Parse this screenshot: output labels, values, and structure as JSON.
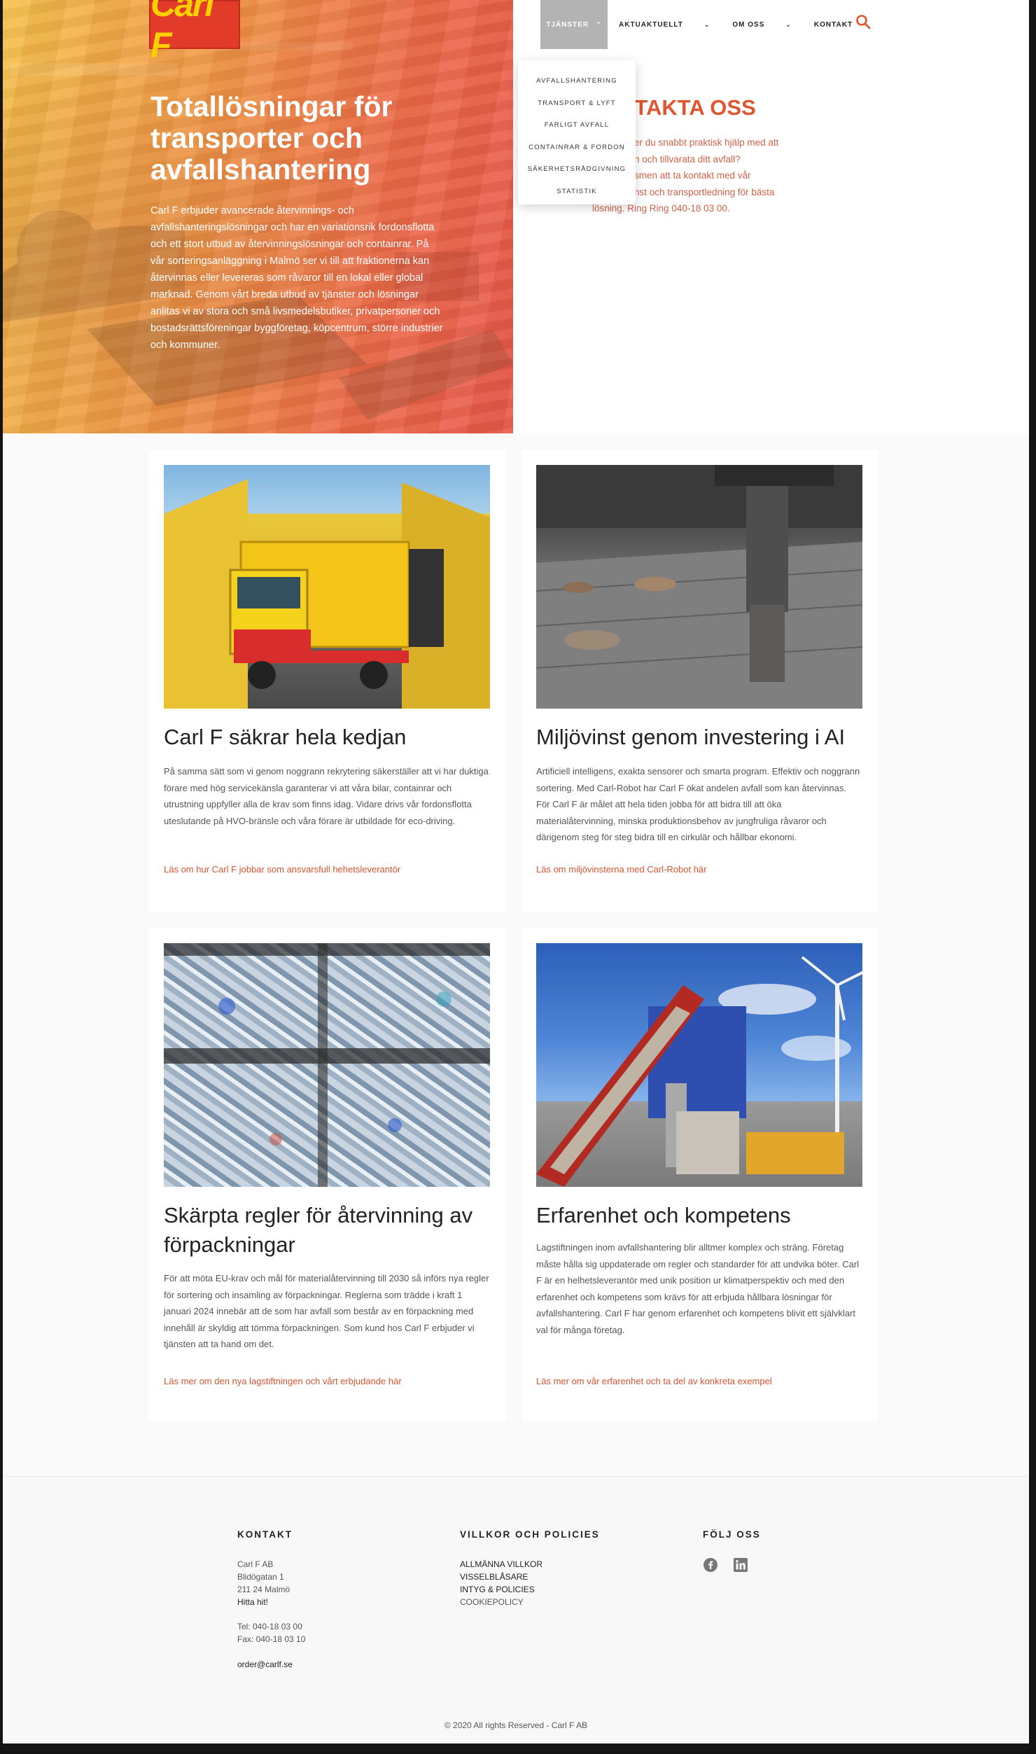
{
  "brand": {
    "logo_text": "Carl F",
    "accent": "#e0562f",
    "logo_bg": "#e23b2a",
    "logo_fg": "#ffd000"
  },
  "nav": {
    "items": [
      {
        "label": "TJÄNSTER",
        "chevron": "⌃"
      },
      {
        "label": "AKTUAKTUELLT",
        "chevron": "⌄"
      },
      {
        "label": "OM OSS",
        "chevron": "⌄"
      },
      {
        "label": "KONTAKT"
      }
    ],
    "search_icon": "search-icon"
  },
  "dropdown": {
    "items": [
      "AVFALLSHANTERING",
      "TRANSPORT & LYFT",
      "FARLIGT AVFALL",
      "CONTAINRAR & FORDON",
      "SÄKERHETSRÅDGIVNING",
      "STATISTIK"
    ]
  },
  "hero": {
    "title": "Totallösningar för transporter och avfallshantering",
    "text": "Carl F erbjuder avancerade återvinnings- och avfallshanteringslösningar och har en variationsrik fordonsflotta och ett stort utbud av återvinningslösningar och containrar. På vår sorteringsanläggning i Malmö ser vi till att fraktionerna kan återvinnas eller  levereras som råvaror till en lokal eller global marknad. Genom vårt breda utbud av tjänster och lösningar anlitas vi av stora och små livsmedelsbutiker, privatpersoner och bostadsrättsföreningar byggföretag, köpcentrum, större industrier och kommuner."
  },
  "contact": {
    "title_visible": "NTAKTA OSS",
    "line1": "er du snabbt praktisk hjälp med att",
    "line2": "n och tillvarata ditt avfall?",
    "line3": "smen att ta kontakt med vår",
    "line4": "nst och transportledning för bästa",
    "line5": "lösning. Ring Ring 040-18 03 00."
  },
  "cards": [
    {
      "title": "Carl F säkrar hela kedjan",
      "text": "På samma sätt som vi genom noggrann rekrytering säkerställer att vi har duktiga förare med hög servicekänsla garanterar vi att våra bilar, containrar och utrustning uppfyller alla de krav som finns idag. Vidare drivs vår fordonsflotta uteslutande på HVO-bränsle och våra förare är utbildade för eco-driving.",
      "link": "Läs om hur Carl F jobbar som ansvarsfull hehetsleverantör"
    },
    {
      "title": "Miljövinst genom investering i AI",
      "text": "Artificiell intelligens, exakta sensorer och smarta program. Effektiv och noggrann sortering. Med Carl-Robot har Carl F ökat andelen avfall som kan återvinnas. För Carl F är målet att hela tiden jobba för att bidra till att öka materialåtervinning, minska produktionsbehov av jungfruliga råvaror och därigenom steg för steg bidra till en cirkulär och hållbar ekonomi.",
      "link": "Läs om miljövinsterna med Carl-Robot här"
    },
    {
      "title": "Skärpta regler för återvinning av förpackningar",
      "text": "För att möta EU-krav och mål för materialåtervinning till 2030 så införs nya regler för sortering och insamling av förpackningar. Reglerna som trädde i kraft 1 januari 2024 innebär att de som har avfall som består av en förpackning med innehåll är skyldig att tömma förpackningen. Som kund hos Carl F erbjuder vi tjänsten att ta hand om det.",
      "link": "Läs mer om den nya lagstiftningen och vårt erbjudande här"
    },
    {
      "title": "Erfarenhet och kompetens",
      "text": "Lagstiftningen inom avfallshantering blir alltmer komplex och sträng. Företag måste hålla sig uppdaterade om regler och standarder för att undvika böter. Carl F är en helhetsleverantör med unik position ur klimatperspektiv och med den erfarenhet och kompetens som krävs för att erbjuda hållbara lösningar för avfallshantering. Carl F har genom erfarenhet och kompetens blivit ett självklart val för många företag.",
      "link": "Läs mer om vår erfarenhet och ta del av konkreta exempel"
    }
  ],
  "footer": {
    "kontakt": {
      "heading": "KONTAKT",
      "company": "Carl F AB",
      "street": "Blidögatan 1",
      "city": "211 24 Malmö",
      "find": "Hitta hit!",
      "tel": "Tel: 040-18 03 00",
      "fax": "Fax: 040-18 03 10",
      "email": "order@carlf.se"
    },
    "villkor": {
      "heading": "VILLKOR OCH POLICIES",
      "links": [
        "ALLMÄNNA VILLKOR",
        "VISSELBLÅSARE",
        "INTYG & POLICIES",
        "COOKIEPOLICY"
      ]
    },
    "follow": {
      "heading": "FÖLJ OSS",
      "icons": [
        "facebook-icon",
        "linkedin-icon"
      ]
    },
    "copyright": "© 2020 All rights Reserved - Carl F AB"
  }
}
